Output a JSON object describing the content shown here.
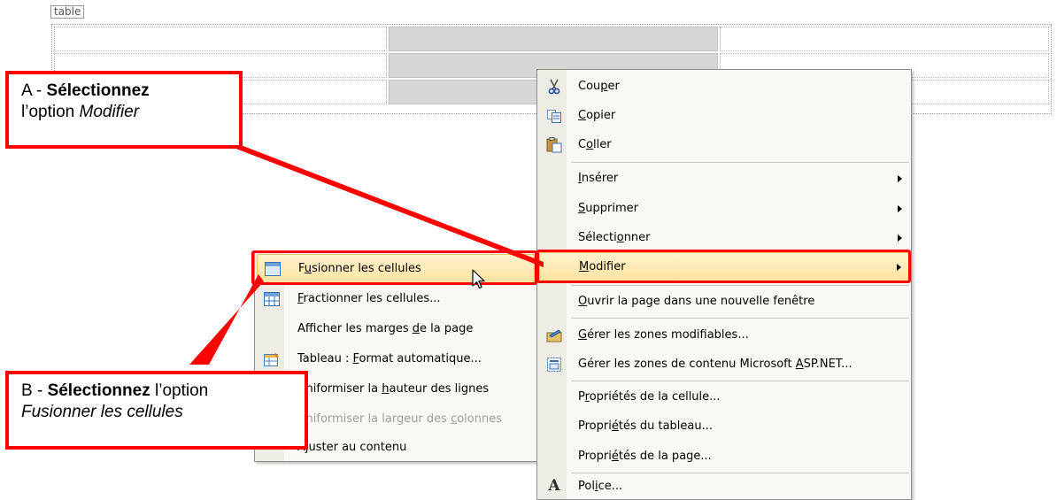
{
  "table_tag": "table",
  "menu_right": {
    "items": [
      {
        "icon": "scissors-icon",
        "pre": "Cou",
        "ul": "p",
        "post": "er",
        "submenu": false
      },
      {
        "icon": "copy-icon",
        "pre": "",
        "ul": "C",
        "post": "opier",
        "submenu": false
      },
      {
        "icon": "paste-icon",
        "pre": "C",
        "ul": "o",
        "post": "ller",
        "submenu": false
      },
      {
        "icon": "",
        "pre": "",
        "ul": "I",
        "post": "nsérer",
        "submenu": true
      },
      {
        "icon": "",
        "pre": "",
        "ul": "S",
        "post": "upprimer",
        "submenu": true
      },
      {
        "icon": "",
        "pre": "Sélecti",
        "ul": "o",
        "post": "nner",
        "submenu": true
      },
      {
        "icon": "",
        "pre": "",
        "ul": "M",
        "post": "odifier",
        "submenu": true
      },
      {
        "icon": "",
        "pre": "",
        "ul": "O",
        "post": "uvrir la page dans une nouvelle fenêtre",
        "submenu": false
      },
      {
        "icon": "editable-regions-icon",
        "pre": "",
        "ul": "G",
        "post": "érer les zones modifiables...",
        "submenu": false
      },
      {
        "icon": "content-regions-icon",
        "pre": "Gérer les zones de contenu Microsoft ",
        "ul": "A",
        "post": "SP.NET...",
        "submenu": false
      },
      {
        "icon": "",
        "pre": "P",
        "ul": "r",
        "post": "opriétés de la cellule...",
        "submenu": false
      },
      {
        "icon": "",
        "pre": "Propri",
        "ul": "é",
        "post": "tés du tableau...",
        "submenu": false
      },
      {
        "icon": "",
        "pre": "Propri",
        "ul": "é",
        "post": "tés de la page...",
        "submenu": false
      },
      {
        "icon": "font-icon",
        "pre": "Pol",
        "ul": "i",
        "post": "ce...",
        "submenu": false
      }
    ]
  },
  "menu_left": {
    "items": [
      {
        "icon": "merge-cells-icon",
        "pre": "F",
        "ul": "u",
        "post": "sionner les cellules",
        "disabled": false
      },
      {
        "icon": "split-cells-icon",
        "pre": "",
        "ul": "F",
        "post": "ractionner les cellules...",
        "disabled": false
      },
      {
        "icon": "",
        "pre": "Afficher les marges ",
        "ul": "d",
        "post": "e la page",
        "disabled": false
      },
      {
        "icon": "table-autoformat-icon",
        "pre": "Tableau : ",
        "ul": "F",
        "post": "ormat automatique...",
        "disabled": false
      },
      {
        "icon": "",
        "pre": "Uniformiser la ",
        "ul": "h",
        "post": "auteur des lignes",
        "disabled": false
      },
      {
        "icon": "",
        "pre": "Uniformiser la largeur des ",
        "ul": "c",
        "post": "olonnes",
        "disabled": true
      },
      {
        "icon": "",
        "pre": "Ajuster au contenu",
        "ul": "",
        "post": "",
        "disabled": false
      }
    ]
  },
  "callout_a": {
    "prefix": "A - ",
    "bold": "Sélectionnez",
    "line2_prefix": "l’option ",
    "italic": "Modifier"
  },
  "callout_b": {
    "prefix": "B - ",
    "bold": "Sélectionnez",
    "suffix": " l’option",
    "italic": "Fusionner les cellules"
  },
  "colors": {
    "highlight_border": "#ff0000",
    "menu_hover": "#fde3a0",
    "menu_bg": "#f9f8f4"
  }
}
